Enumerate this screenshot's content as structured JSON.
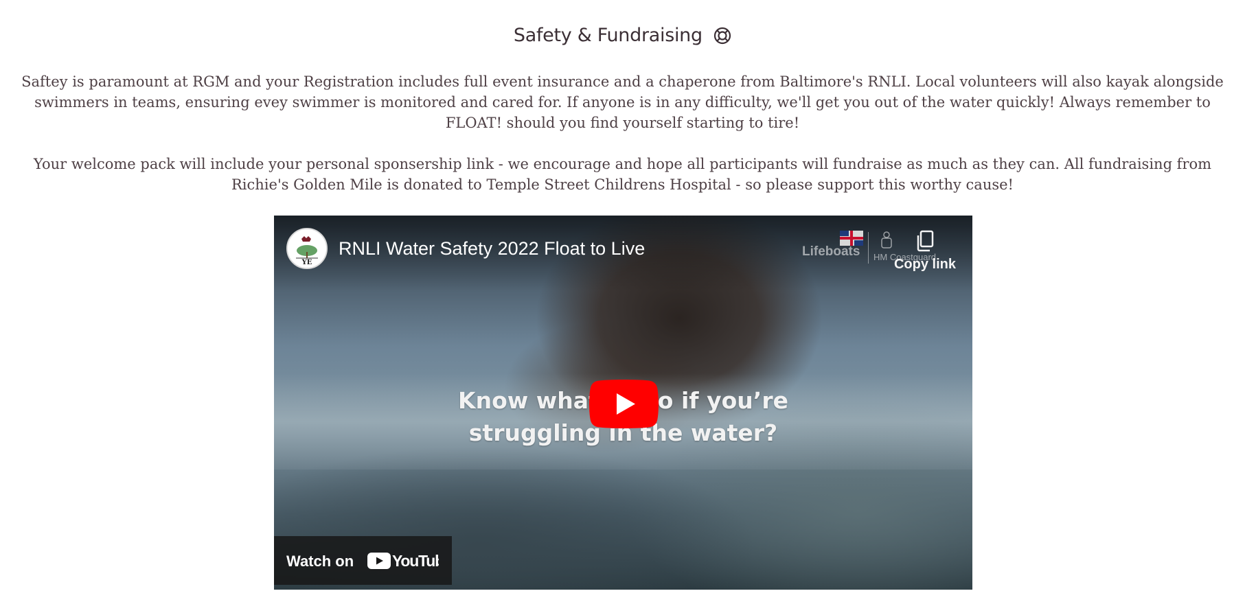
{
  "section": {
    "title": "Safety & Fundraising",
    "paragraph_1": "Saftey is paramount at RGM and your Registration includes full event insurance and a chaperone from Baltimore's RNLI. Local volunteers will also kayak alongside swimmers in teams, ensuring evey swimmer is monitored and cared for. If anyone is in any difficulty, we'll get you out of the water quickly! Always remember to FLOAT! should you find yourself starting to tire!",
    "paragraph_2": "Your welcome pack will include your personal sponsership link - we encourage and hope all participants will fundraise as much as they can. All fundraising from Richie's Golden Mile is donated to Temple Street Childrens Hospital - so please support this worthy cause!"
  },
  "video": {
    "title": "RNLI Water Safety 2022 Float to Live",
    "copy_link_label": "Copy link",
    "brand_lifeboats": "Lifeboats",
    "brand_coastguard": "HM Coastguard",
    "caption_line_1": "Know what to do if you’re",
    "caption_line_2": "struggling in the water?",
    "watch_on_label": "Watch on",
    "youtube_wordmark": "YouTube",
    "channel_avatar_text": "YE",
    "colors": {
      "play_button": "#ff0000",
      "overlay_bar": "#171717"
    },
    "icons": {
      "title_icon": "lifebuoy-icon",
      "copy": "copy-icon",
      "play": "play-icon"
    }
  }
}
